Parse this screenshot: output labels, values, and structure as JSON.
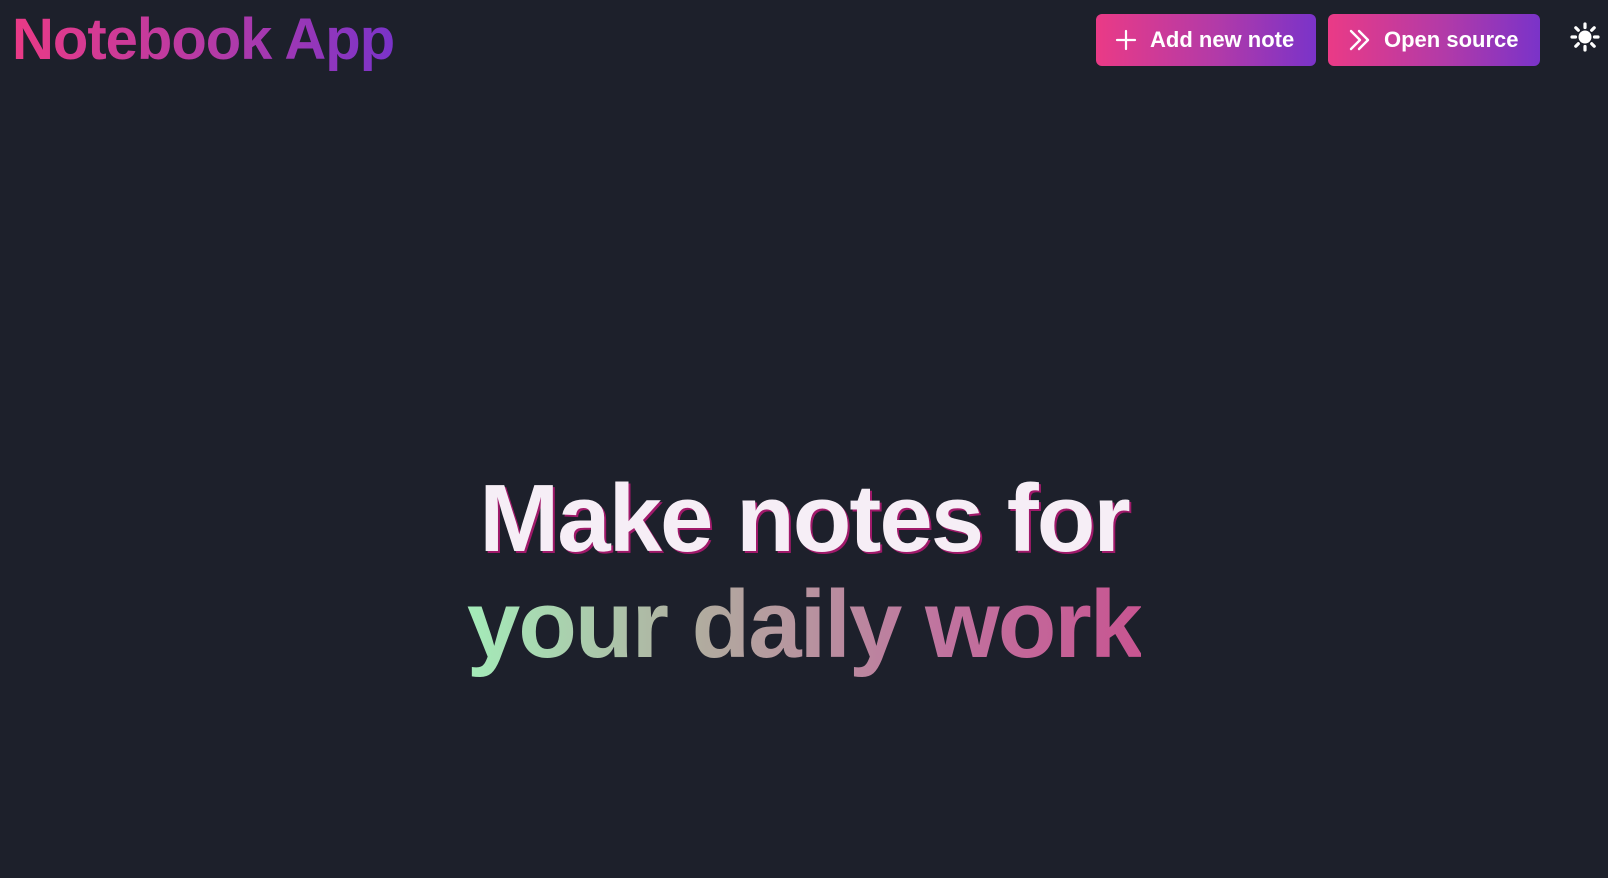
{
  "app": {
    "title": "Notebook App"
  },
  "header": {
    "add_note_label": "Add new note",
    "add_note_icon": "plus-icon",
    "open_source_label": "Open source",
    "open_source_icon": "double-chevron-right-icon",
    "theme_toggle_icon": "sun-icon"
  },
  "hero": {
    "line1": "Make notes for",
    "line2": "your daily work"
  },
  "colors": {
    "background": "#1d202b",
    "brand_gradient_start": "#ea3a86",
    "brand_gradient_end": "#7a33c9",
    "hero_gradient_start": "#a4ecb9",
    "hero_gradient_end": "#c85591",
    "hero_line1_text": "#f6eef6",
    "button_text": "#ffffff"
  }
}
